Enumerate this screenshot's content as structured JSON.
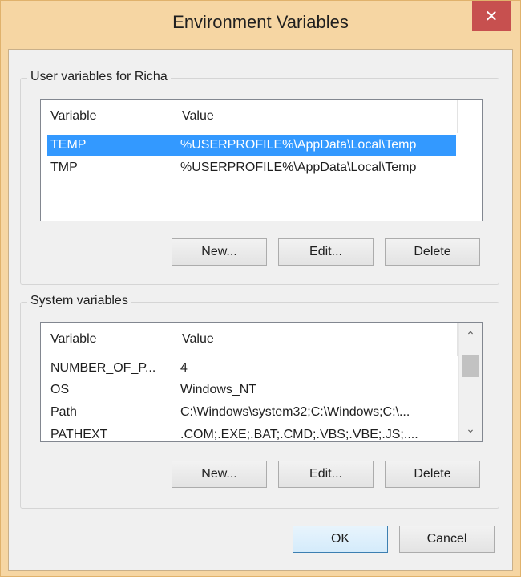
{
  "window": {
    "title": "Environment Variables",
    "close_glyph": "✕"
  },
  "user_variables": {
    "group_label": "User variables for Richa",
    "columns": [
      "Variable",
      "Value"
    ],
    "rows": [
      {
        "variable": "TEMP",
        "value": "%USERPROFILE%\\AppData\\Local\\Temp",
        "selected": true
      },
      {
        "variable": "TMP",
        "value": "%USERPROFILE%\\AppData\\Local\\Temp",
        "selected": false
      }
    ],
    "buttons": {
      "new": "New...",
      "edit": "Edit...",
      "delete": "Delete"
    }
  },
  "system_variables": {
    "group_label": "System variables",
    "columns": [
      "Variable",
      "Value"
    ],
    "rows": [
      {
        "variable": "NUMBER_OF_P...",
        "value": "4"
      },
      {
        "variable": "OS",
        "value": "Windows_NT"
      },
      {
        "variable": "Path",
        "value": "C:\\Windows\\system32;C:\\Windows;C:\\..."
      },
      {
        "variable": "PATHEXT",
        "value": ".COM;.EXE;.BAT;.CMD;.VBS;.VBE;.JS;...."
      }
    ],
    "buttons": {
      "new": "New...",
      "edit": "Edit...",
      "delete": "Delete"
    }
  },
  "footer": {
    "ok": "OK",
    "cancel": "Cancel"
  },
  "colors": {
    "selection": "#3399ff",
    "close_button": "#c7504f",
    "frame": "#f6d6a3"
  }
}
